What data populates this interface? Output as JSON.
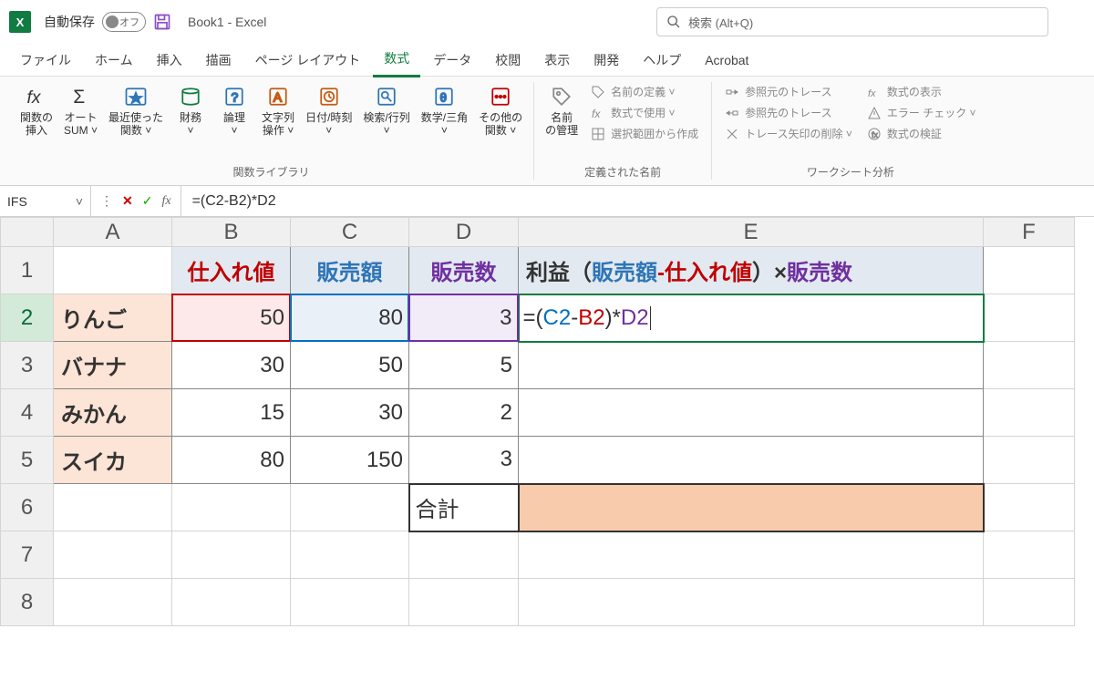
{
  "titlebar": {
    "autosave_label": "自動保存",
    "autosave_state": "オフ",
    "doc_title": "Book1  -  Excel",
    "search_placeholder": "検索 (Alt+Q)"
  },
  "tabs": [
    "ファイル",
    "ホーム",
    "挿入",
    "描画",
    "ページ レイアウト",
    "数式",
    "データ",
    "校閲",
    "表示",
    "開発",
    "ヘルプ",
    "Acrobat"
  ],
  "active_tab": "数式",
  "ribbon": {
    "group1": {
      "label": "関数ライブラリ",
      "items": [
        {
          "icon": "fx",
          "label": "関数の\n挿入"
        },
        {
          "icon": "sum",
          "label": "オート\nSUM ˅"
        },
        {
          "icon": "star",
          "label": "最近使った\n関数 ˅"
        },
        {
          "icon": "book",
          "label": "財務\n˅"
        },
        {
          "icon": "question",
          "label": "論理\n˅"
        },
        {
          "icon": "text",
          "label": "文字列\n操作 ˅"
        },
        {
          "icon": "clock",
          "label": "日付/時刻\n˅"
        },
        {
          "icon": "search",
          "label": "検索/行列\n˅"
        },
        {
          "icon": "theta",
          "label": "数学/三角\n˅"
        },
        {
          "icon": "dots",
          "label": "その他の\n関数 ˅"
        }
      ]
    },
    "group2": {
      "label": "定義された名前",
      "main": {
        "icon": "tag",
        "label": "名前\nの管理"
      },
      "sub": [
        "名前の定義  ˅",
        "数式で使用 ˅",
        "選択範囲から作成"
      ]
    },
    "group3": {
      "label": "ワークシート分析",
      "col1": [
        "参照元のトレース",
        "参照先のトレース",
        "トレース矢印の削除  ˅"
      ],
      "col2": [
        "数式の表示",
        "エラー チェック  ˅",
        "数式の検証"
      ]
    }
  },
  "formula_bar": {
    "name_box": "IFS",
    "formula": "=(C2-B2)*D2"
  },
  "columns": [
    "A",
    "B",
    "C",
    "D",
    "E",
    "F"
  ],
  "rows": [
    "1",
    "2",
    "3",
    "4",
    "5",
    "6",
    "7",
    "8"
  ],
  "headers": {
    "B1": "仕入れ値",
    "C1": "販売額",
    "D1": "販売数",
    "E1_parts": [
      "利益（",
      "販売額",
      "-",
      "仕入れ値",
      "）×",
      "販売数"
    ]
  },
  "data": {
    "A2": "りんご",
    "B2": "50",
    "C2": "80",
    "D2": "3",
    "A3": "バナナ",
    "B3": "30",
    "C3": "50",
    "D3": "5",
    "A4": "みかん",
    "B4": "15",
    "C4": "30",
    "D4": "2",
    "A5": "スイカ",
    "B5": "80",
    "C5": "150",
    "D5": "3",
    "D6": "合計"
  },
  "editing": {
    "cell": "E2",
    "parts": [
      "=(",
      "C2",
      "-",
      "B2",
      ")*",
      "D2"
    ]
  }
}
